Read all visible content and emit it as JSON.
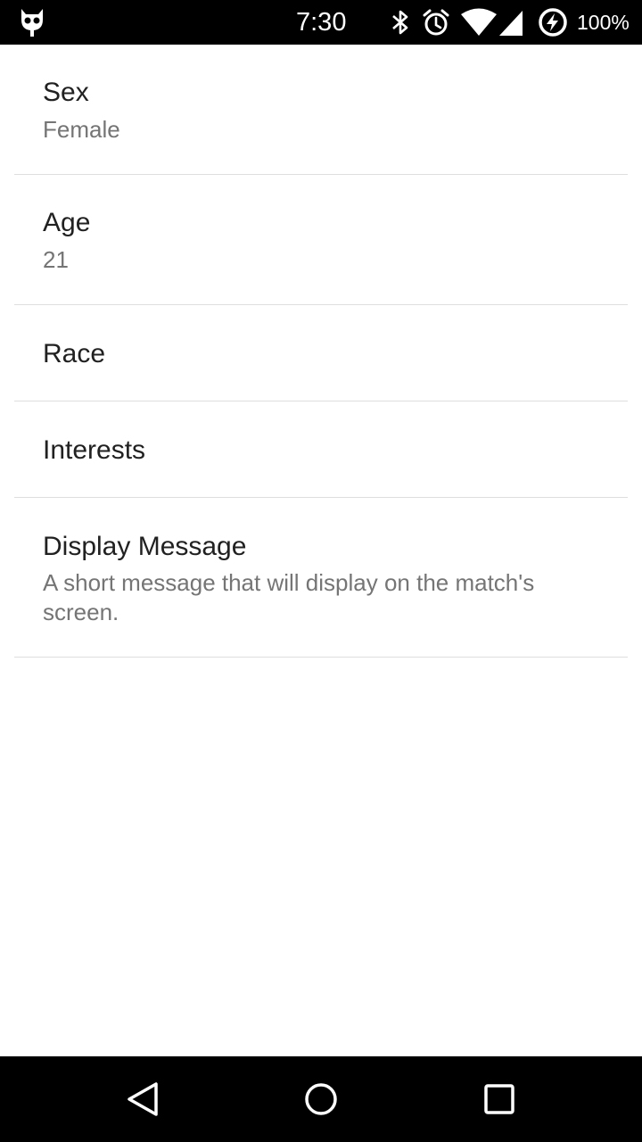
{
  "status_bar": {
    "time": "7:30",
    "battery_text": "100%",
    "icons": [
      "cyanogen-app-icon",
      "bluetooth-icon",
      "alarm-icon",
      "wifi-icon",
      "cell-signal-icon",
      "battery-charging-icon"
    ]
  },
  "preferences": [
    {
      "title": "Sex",
      "summary": "Female"
    },
    {
      "title": "Age",
      "summary": "21"
    },
    {
      "title": "Race",
      "summary": ""
    },
    {
      "title": "Interests",
      "summary": ""
    },
    {
      "title": "Display Message",
      "summary": "A short message that will display on the match's screen."
    }
  ],
  "nav_bar": {
    "buttons": [
      "back-icon",
      "home-icon",
      "recents-icon"
    ]
  },
  "colors": {
    "status_bar_bg": "#000000",
    "title_text": "#212121",
    "summary_text": "#757575",
    "divider": "#dedede"
  }
}
